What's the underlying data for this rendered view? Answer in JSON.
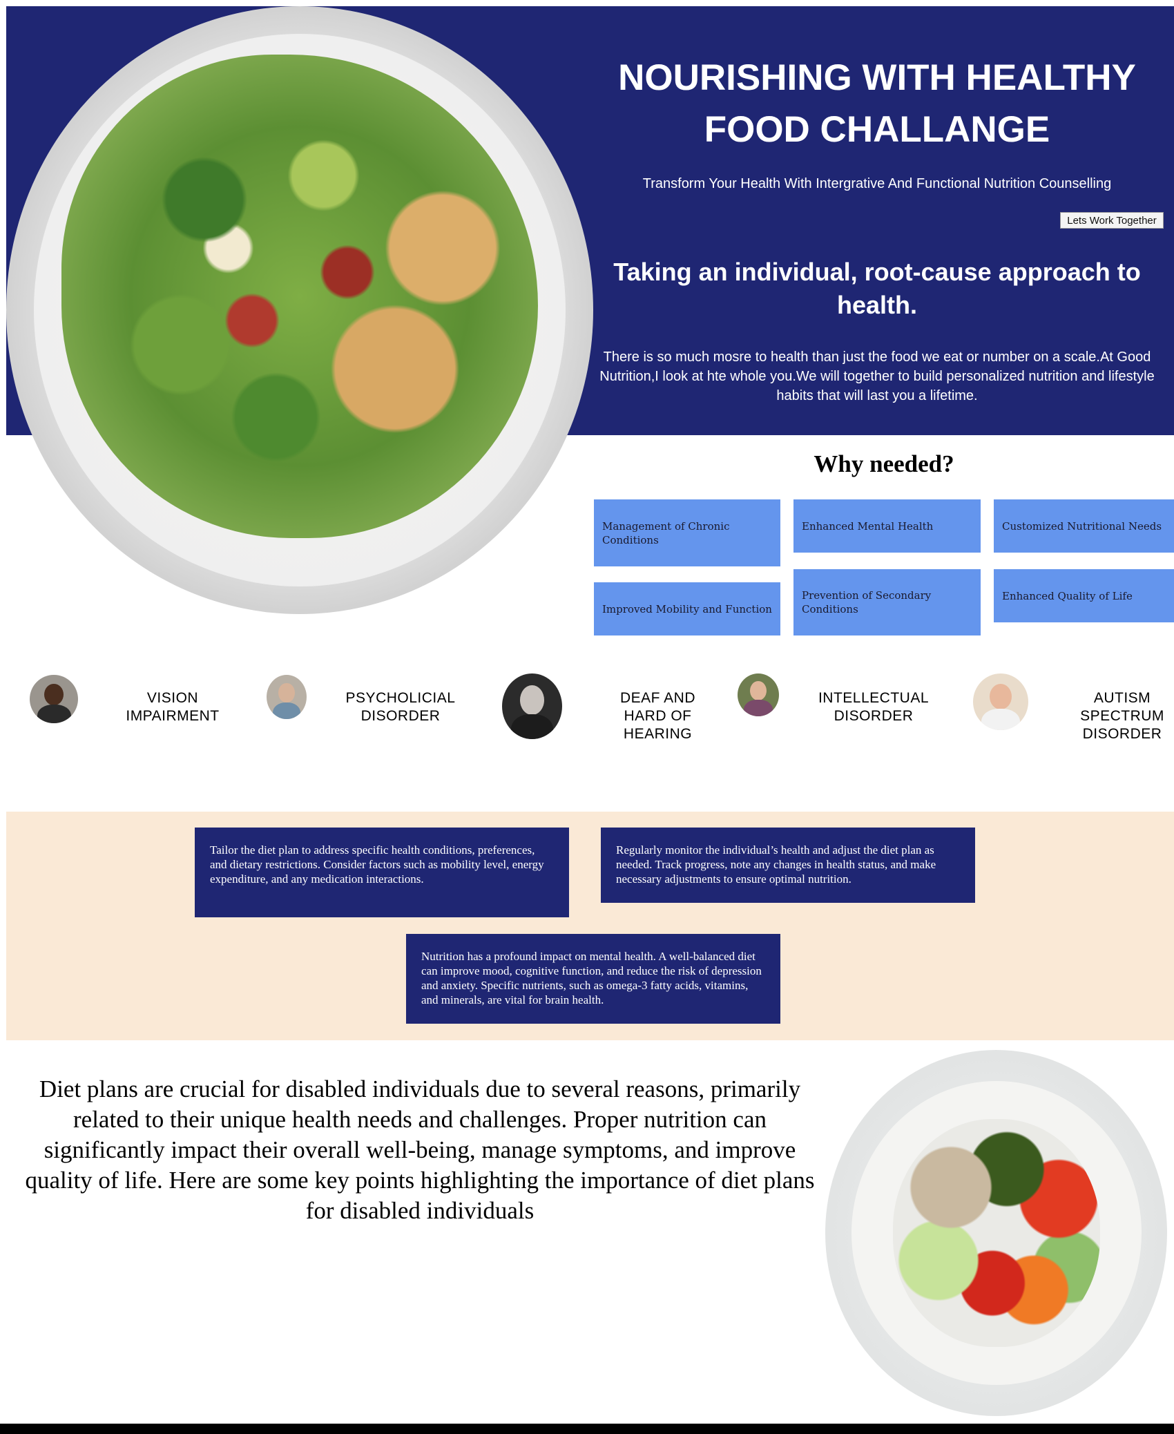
{
  "hero": {
    "title": "NOURISHING WITH HEALTHY FOOD CHALLANGE",
    "subtitle": "Transform Your Health With Intergrative And Functional Nutrition Counselling",
    "cta_label": "Lets Work Together",
    "approach_title": "Taking an individual, root-cause approach to health.",
    "approach_text": "There is so much mosre to health than just the food we eat or number on a scale.At Good Nutrition,I look at hte whole you.We will together to build personalized nutrition and lifestyle habits that will last you a lifetime."
  },
  "why": {
    "title": "Why needed?",
    "cards": [
      "Management of Chronic Conditions",
      "Enhanced Mental Health",
      "Customized Nutritional Needs",
      "Improved Mobility and Function",
      "Prevention of Secondary Conditions",
      "Enhanced Quality of Life"
    ]
  },
  "disabilities": [
    "VISION IMPAIRMENT",
    "PSYCHOLICIAL DISORDER",
    "DEAF AND HARD OF HEARING",
    "INTELLECTUAL DISORDER",
    "AUTISM SPECTRUM DISORDER"
  ],
  "info_cards": [
    "Tailor the diet plan to address specific health conditions, preferences, and dietary restrictions. Consider factors such as mobility level, energy expenditure, and any medication interactions.",
    "Regularly monitor the individual’s health and adjust the diet plan as needed. Track progress, note any changes in health status, and make necessary adjustments to ensure optimal nutrition.",
    "Nutrition has a profound impact on mental health. A well-balanced diet can improve mood, cognitive function, and reduce the risk of depression and anxiety. Specific nutrients, such as omega-3 fatty acids, vitamins, and minerals, are vital for brain health."
  ],
  "diet_text": "Diet plans are crucial for disabled individuals due to several reasons, primarily related to their unique health needs and challenges. Proper nutrition can significantly impact their overall well-being, manage symptoms, and improve quality of life. Here are some key points highlighting the importance of diet plans for disabled individuals",
  "colors": {
    "hero_bg": "#1f2673",
    "card_blue": "#6495ed",
    "peach_bg": "#fae9d6",
    "info_card_bg": "#1f2673"
  }
}
